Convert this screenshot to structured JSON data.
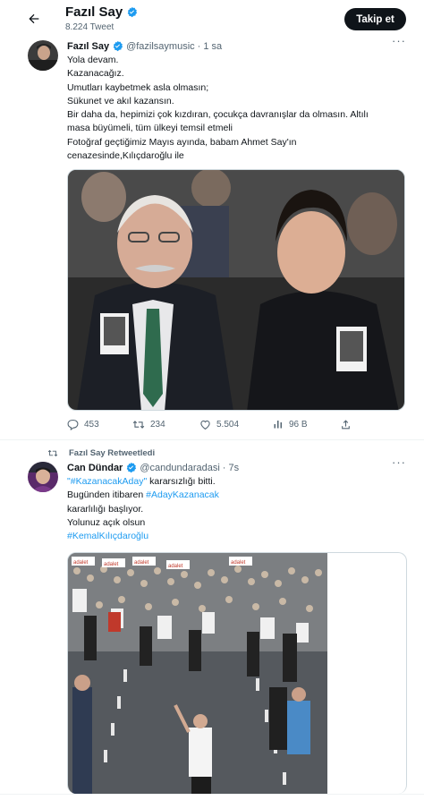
{
  "header": {
    "display_name": "Fazıl Say",
    "tweet_count": "8.224 Tweet",
    "follow_label": "Takip et",
    "back_icon": "arrow-left-icon"
  },
  "tweet1": {
    "name": "Fazıl Say",
    "handle": "@fazilsaymusic",
    "time": "· 1 sa",
    "lines": [
      "Yola devam.",
      "Kazanacağız.",
      "Umutları kaybetmek asla olmasın;",
      "Sükunet ve akıl kazansın.",
      "Bir daha da, hepimizi çok kızdıran, çocukça davranışlar da olmasın. Altılı",
      "masa büyümeli, tüm ülkeyi temsil etmeli",
      "Fotoğraf geçtiğimiz Mayıs ayında, babam Ahmet Say'ın",
      "cenazesinde,Kılıçdaroğlu ile"
    ],
    "stats": {
      "replies": "453",
      "retweets": "234",
      "likes": "5.504",
      "views": "96 B"
    }
  },
  "tweet2": {
    "retweeted_by": "Fazıl Say Retweetledi",
    "name": "Can Dündar",
    "handle": "@candundaradasi",
    "time": "· 7s",
    "line1_link": "\"#KazanacakAday\"",
    "line1_rest": " kararsızlığı bitti.",
    "line2_text": "Bugünden itibaren ",
    "line2_link": "#AdayKazanacak",
    "line3": "kararlılığı başlıyor.",
    "line4": "Yolunuz açık olsun",
    "line5_link": "#KemalKılıçdaroğlu",
    "banner_words": [
      "adalet",
      "adalet",
      "adalet",
      "adalet",
      "adalet"
    ]
  },
  "colors": {
    "accent": "#1d9bf0",
    "text": "#0f1419",
    "muted": "#536471",
    "border": "#eff3f4"
  }
}
